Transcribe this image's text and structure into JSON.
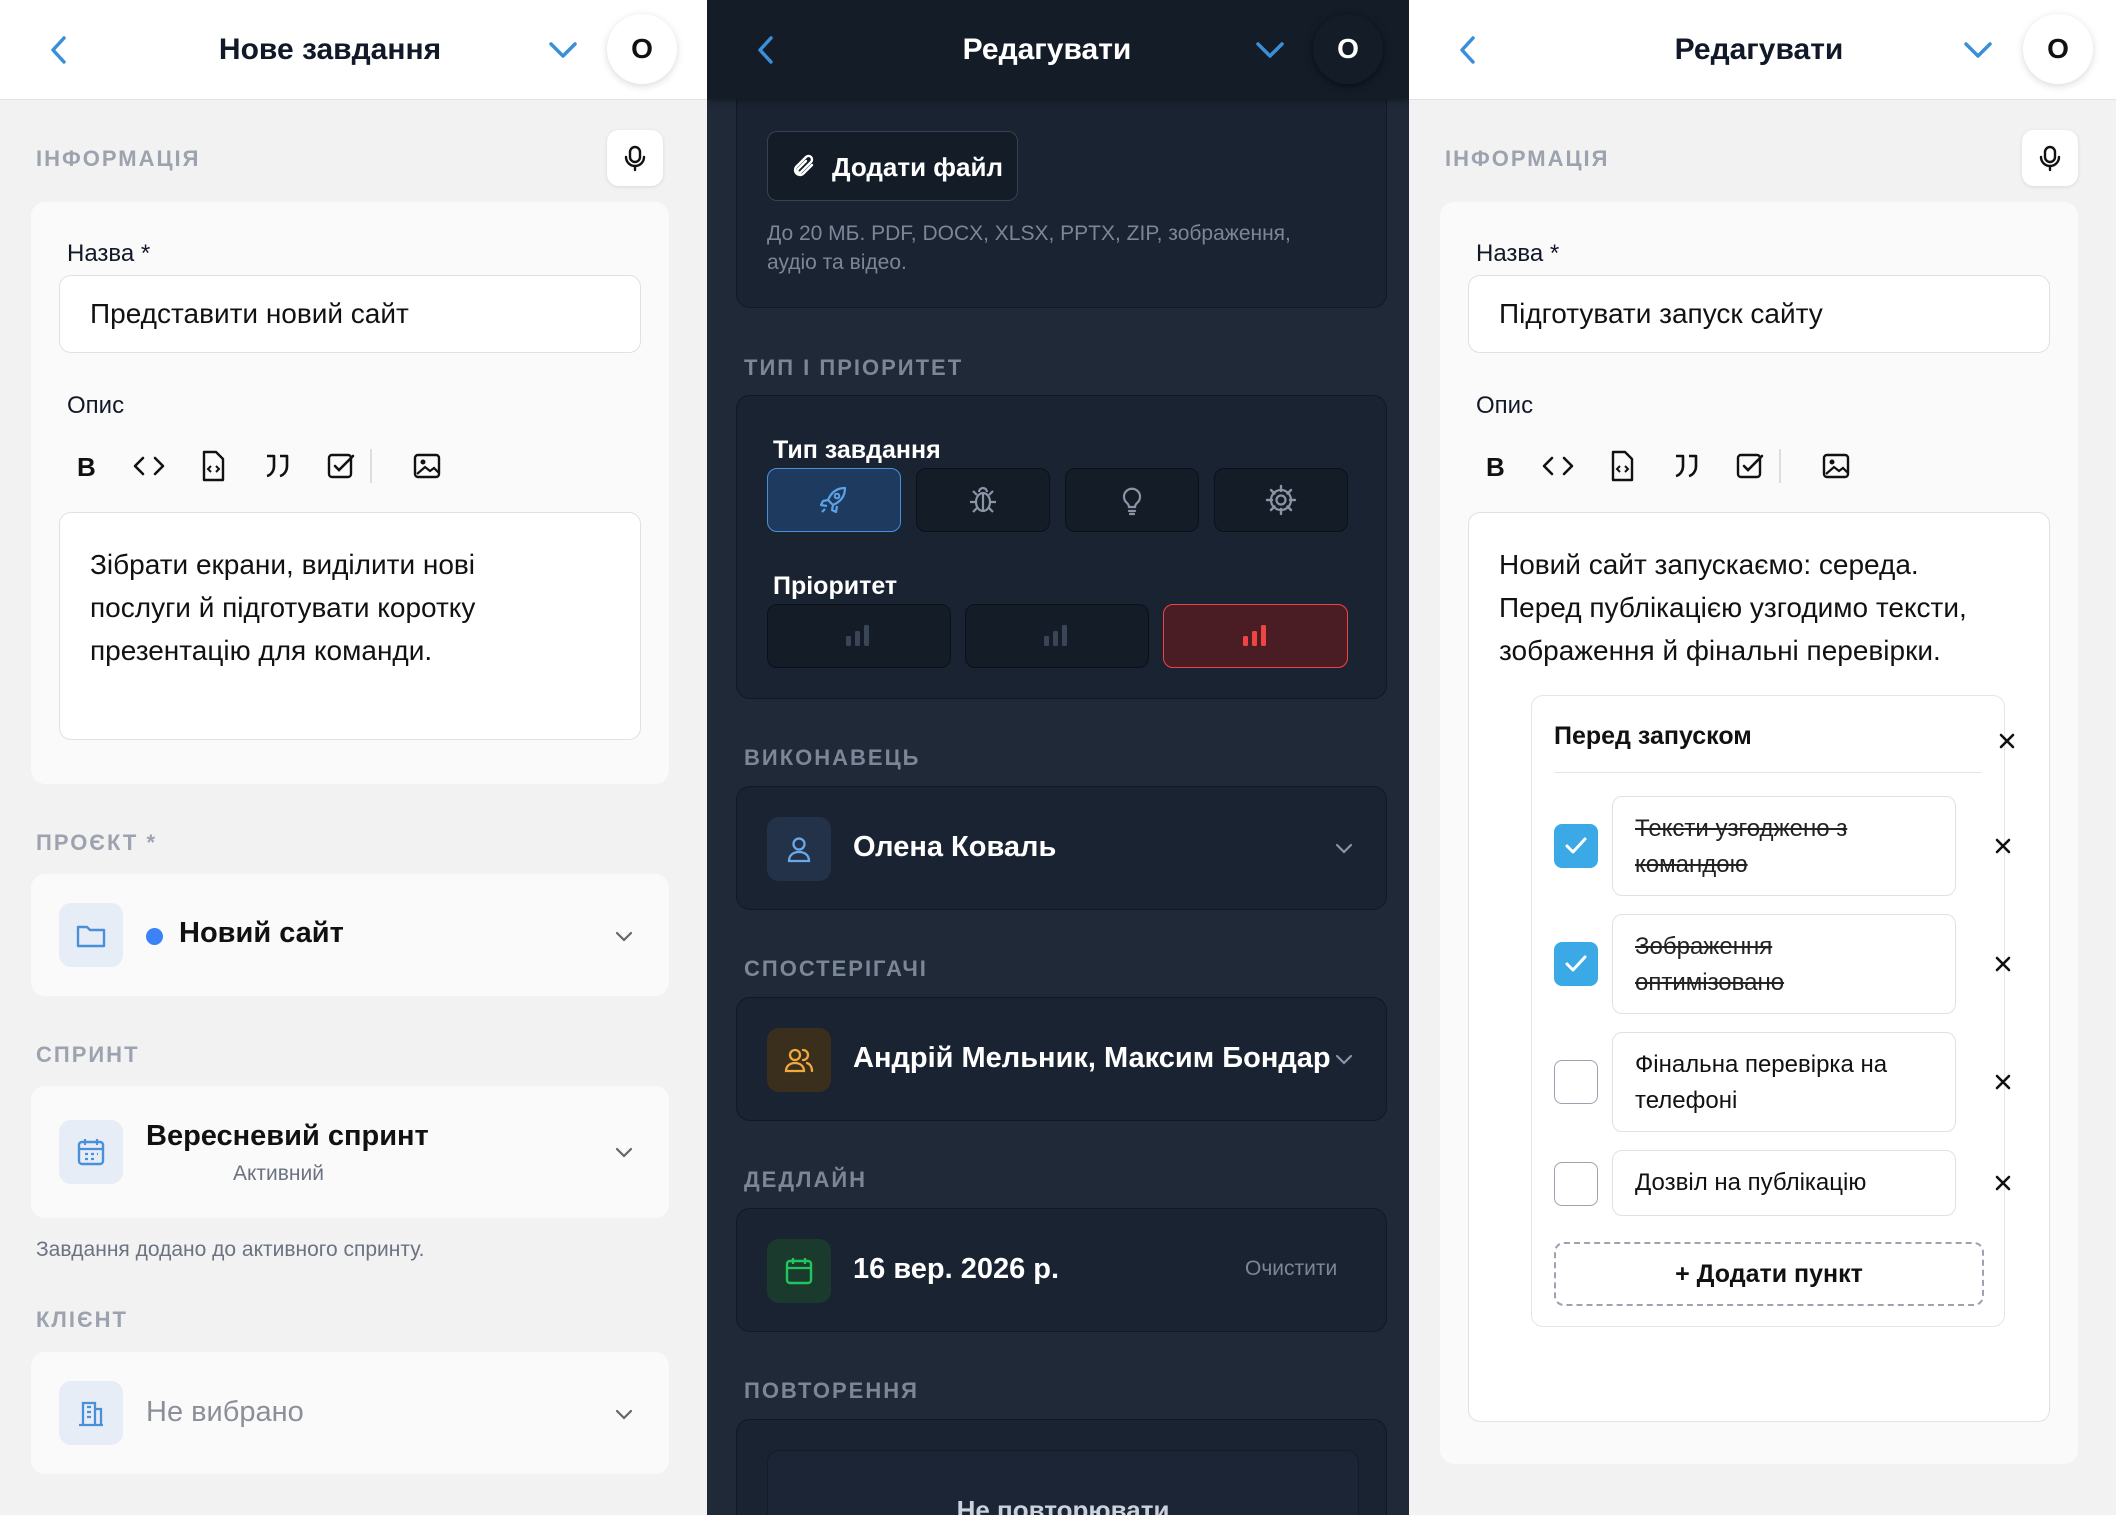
{
  "panel1": {
    "header": {
      "title": "Нове завдання",
      "avatar": "O"
    },
    "section_info": "ІНФОРМАЦІЯ",
    "name_label": "Назва *",
    "name_value": "Представити новий сайт",
    "desc_label": "Опис",
    "desc_lines": [
      "Зібрати екрани, виділити нові",
      "послуги й підготувати коротку",
      "презентацію для команди."
    ],
    "section_project": "ПРОЄКТ *",
    "project_value": "Новий сайт",
    "project_dot_color": "#3b82f6",
    "section_sprint": "СПРИНТ",
    "sprint_value": "Вересневий спринт",
    "sprint_status": "Активний",
    "sprint_hint": "Завдання додано до активного спринту.",
    "section_client": "КЛІЄНТ",
    "client_value": "Не вибрано"
  },
  "panel2": {
    "header": {
      "title": "Редагувати",
      "avatar": "O"
    },
    "attach_label": "Додати файл",
    "attach_hint_lines": [
      "До 20 МБ. PDF, DOCX, XLSX, PPTX, ZIP, зображення,",
      "аудіо та відео."
    ],
    "section_type": "ТИП І ПРІОРИТЕТ",
    "type_label": "Тип завдання",
    "type_options": [
      "rocket-icon",
      "bug-icon",
      "lightbulb-icon",
      "gear-icon"
    ],
    "priority_label": "Пріоритет",
    "priority_accent": "#ef4444",
    "section_assignee": "ВИКОНАВЕЦЬ",
    "assignee_value": "Олена Коваль",
    "section_watchers": "СПОСТЕРІГАЧІ",
    "watchers_value": "Андрій Мельник, Максим Бондар",
    "section_deadline": "ДЕДЛАЙН",
    "deadline_value": "16 вер. 2026 р.",
    "deadline_clear": "Очистити",
    "section_repeat": "ПОВТОРЕННЯ",
    "repeat_value": "Не повторювати"
  },
  "panel3": {
    "header": {
      "title": "Редагувати",
      "avatar": "O"
    },
    "section_info": "ІНФОРМАЦІЯ",
    "name_label": "Назва *",
    "name_value": "Підготувати запуск сайту",
    "desc_label": "Опис",
    "desc_lines": [
      "Новий сайт запускаємо: середа.",
      "Перед публікацією узгодимо тексти,",
      "зображення й фінальні перевірки."
    ],
    "checklist": {
      "title": "Перед запуском",
      "items": [
        {
          "lines": [
            "Тексти узгоджено з",
            "командою"
          ],
          "done": true
        },
        {
          "lines": [
            "Зображення",
            "оптимізовано"
          ],
          "done": true
        },
        {
          "lines": [
            "Фінальна перевірка на",
            "телефоні"
          ],
          "done": false
        },
        {
          "lines": [
            "Дозвіл на публікацію"
          ],
          "done": false
        }
      ],
      "add_label": "+ Додати пункт"
    }
  }
}
